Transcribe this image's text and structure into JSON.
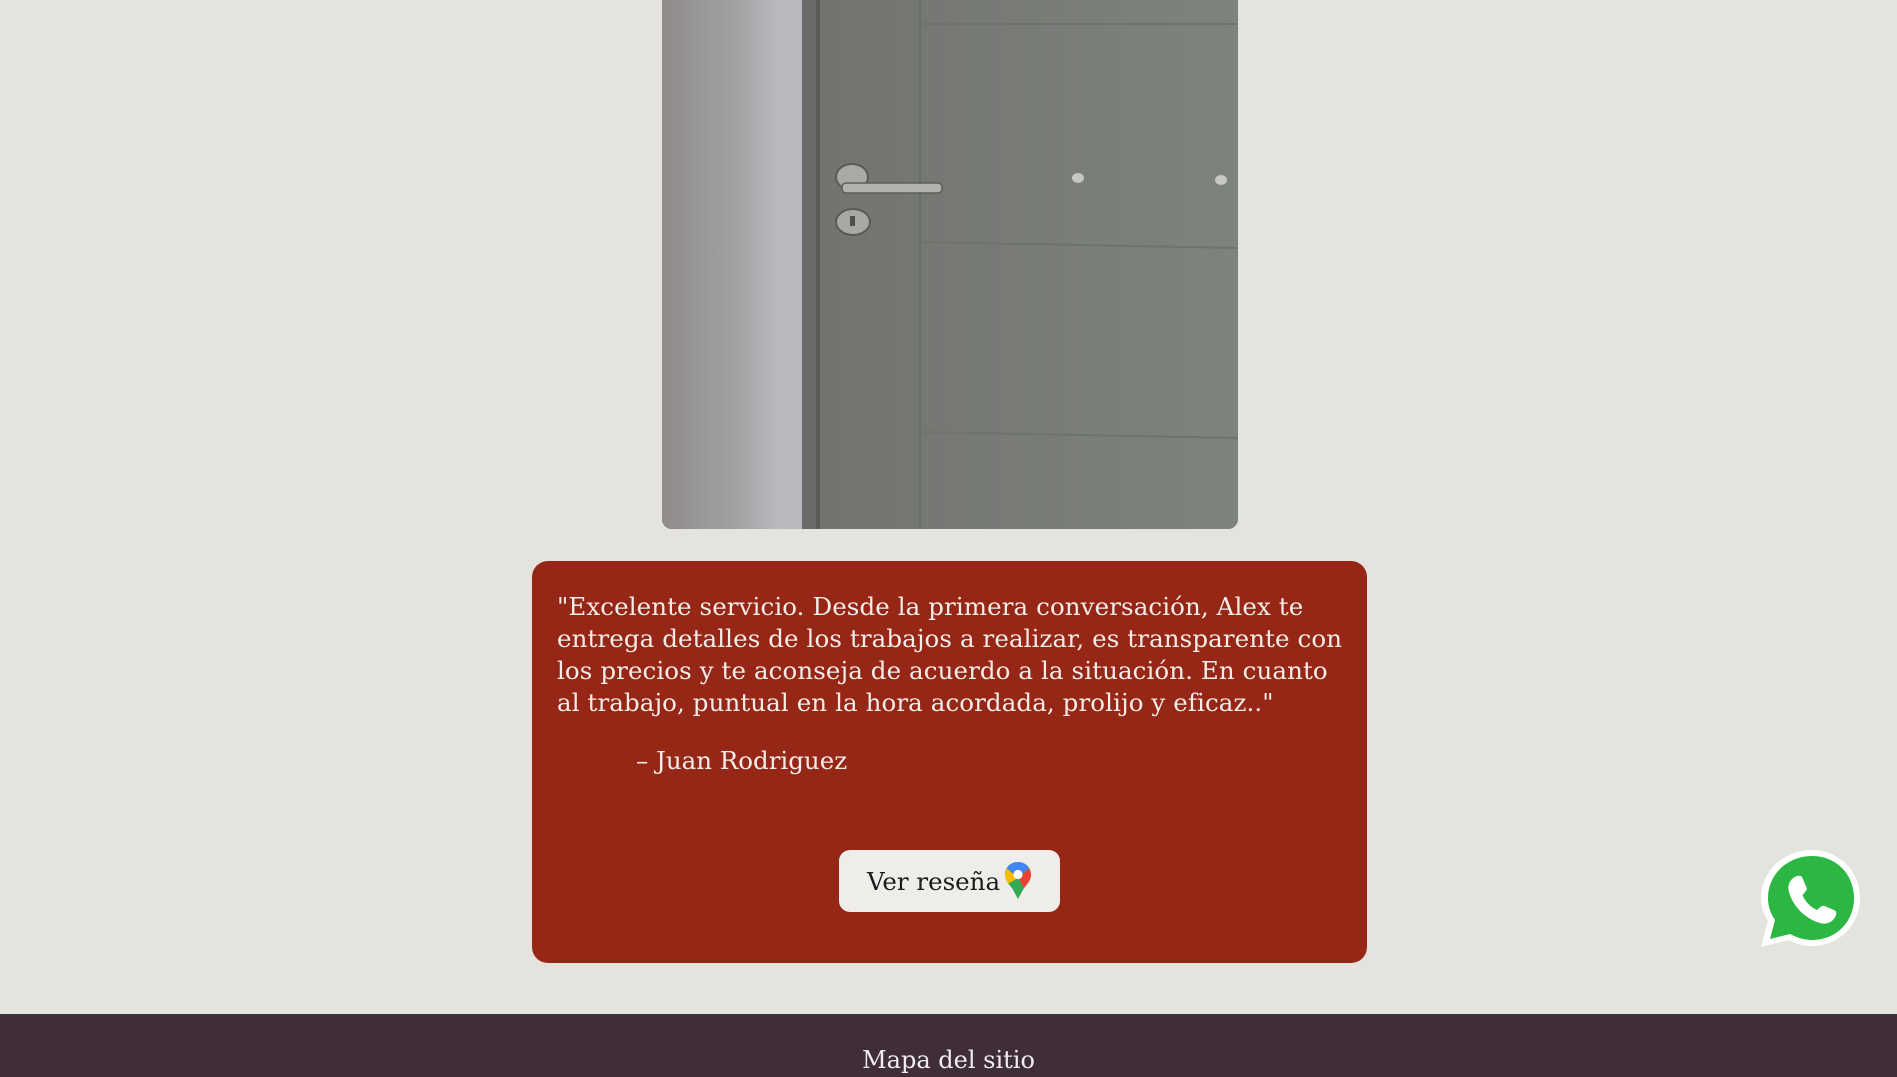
{
  "gallery": {
    "image_description_name": "door-photo"
  },
  "review": {
    "text": "\"Excelente servicio. Desde la primera conversación, Alex te entrega detalles de los trabajos a realizar, es transparente con los precios y te aconseja de acuerdo a la situación. En cuanto al trabajo, puntual en la hora acordada, prolijo y eficaz..\"",
    "author": "– Juan Rodriguez",
    "button_label": "Ver reseña",
    "button_icon": "google-maps-pin-icon"
  },
  "floating": {
    "whatsapp_icon": "whatsapp-icon"
  },
  "footer": {
    "sitemap_label": "Mapa del sitio"
  },
  "colors": {
    "background": "#e4e3dd",
    "card": "#962716",
    "footer": "#3f2e3a",
    "whatsapp": "#2cb742"
  }
}
